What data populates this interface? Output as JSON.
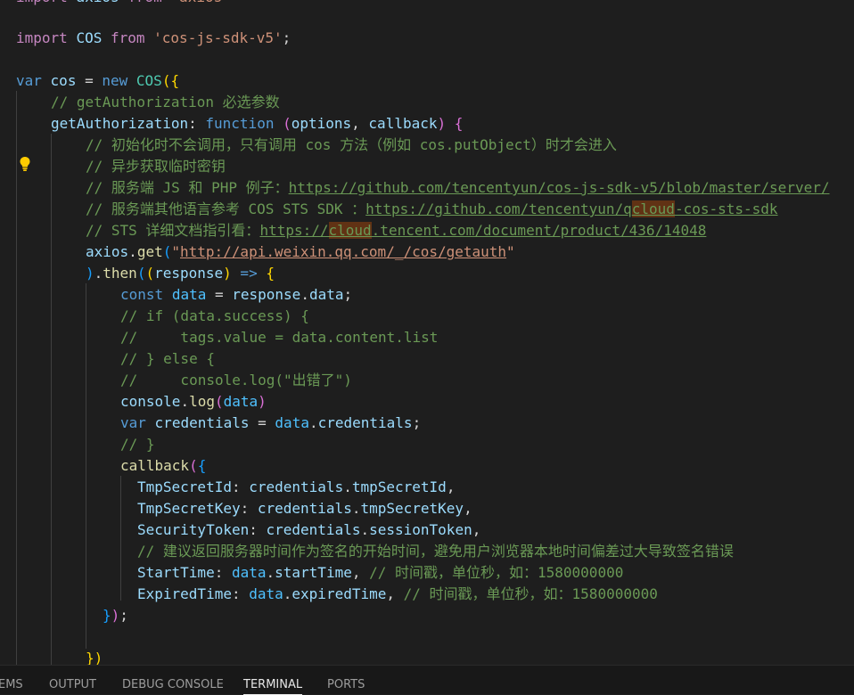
{
  "editor": {
    "language": "javascript",
    "lines": {
      "l0": "import axios from 'axios'",
      "l2_import": "import",
      "l2_name": "COS",
      "l2_from": "from",
      "l2_module": "'cos-js-sdk-v5'",
      "l2_semi": ";",
      "l4_var": "var",
      "l4_name": "cos",
      "l4_eq": " = ",
      "l4_new": "new",
      "l4_cls": "COS",
      "l4_open": "({",
      "l5_comment": "// getAuthorization 必选参数",
      "l6_key": "getAuthorization",
      "l6_colon": ": ",
      "l6_function": "function",
      "l6_params_open": " (",
      "l6_p1": "options",
      "l6_comma": ", ",
      "l6_p2": "callback",
      "l6_params_close": ") {",
      "l7_comment": "// 初始化时不会调用，只有调用 cos 方法（例如 cos.putObject）时才会进入",
      "l8_comment": "// 异步获取临时密钥",
      "l9_comment_prefix": "// 服务端 JS 和 PHP 例子：",
      "l9_link": "https://github.com/tencentyun/cos-js-sdk-v5/blob/master/server/",
      "l10_comment_prefix": "// 服务端其他语言参考 COS STS SDK ：",
      "l10_link_a": "https://github.com/tencentyun/q",
      "l10_link_hl": "cloud",
      "l10_link_b": "-cos-sts-sdk",
      "l11_comment_prefix": "// STS 详细文档指引看：",
      "l11_link_a": "https://",
      "l11_link_hl": "cloud",
      "l11_link_b": ".tencent.com/document/product/436/14048",
      "l12_obj": "axios",
      "l12_dot": ".",
      "l12_fn": "get",
      "l12_open": "(",
      "l12_q1": "\"",
      "l12_url": "http://api.weixin.qq.com/_/cos/getauth",
      "l12_q2": "\"",
      "l13_close": ")",
      "l13_dot": ".",
      "l13_fn": "then",
      "l13_open1": "(",
      "l13_open2": "(",
      "l13_param": "response",
      "l13_close2": ")",
      "l13_arrow": " => ",
      "l13_brace": "{",
      "l14_const": "const",
      "l14_name": "data",
      "l14_eq": " = ",
      "l14_obj": "response",
      "l14_dot": ".",
      "l14_prop": "data",
      "l14_semi": ";",
      "l15_comment": "// if (data.success) {",
      "l16_comment": "//     tags.value = data.content.list",
      "l17_comment": "// } else {",
      "l18_comment": "//     console.log(\"出错了\")",
      "l19_obj": "console",
      "l19_dot": ".",
      "l19_fn": "log",
      "l19_open": "(",
      "l19_arg": "data",
      "l19_close": ")",
      "l20_var": "var",
      "l20_name": "credentials",
      "l20_eq": " = ",
      "l20_obj": "data",
      "l20_dot": ".",
      "l20_prop": "credentials",
      "l20_semi": ";",
      "l21_comment": "// }",
      "l22_fn": "callback",
      "l22_open1": "(",
      "l22_open2": "{",
      "l23_key": "TmpSecretId",
      "l23_colon": ": ",
      "l23_obj": "credentials",
      "l23_dot": ".",
      "l23_prop": "tmpSecretId",
      "l23_comma": ",",
      "l24_key": "TmpSecretKey",
      "l24_colon": ": ",
      "l24_obj": "credentials",
      "l24_dot": ".",
      "l24_prop": "tmpSecretKey",
      "l24_comma": ",",
      "l25_key": "SecurityToken",
      "l25_colon": ": ",
      "l25_obj": "credentials",
      "l25_dot": ".",
      "l25_prop": "sessionToken",
      "l25_comma": ",",
      "l26_comment": "// 建议返回服务器时间作为签名的开始时间，避免用户浏览器本地时间偏差过大导致签名错误",
      "l27_key": "StartTime",
      "l27_colon": ": ",
      "l27_obj": "data",
      "l27_dot": ".",
      "l27_prop": "startTime",
      "l27_comma": ", ",
      "l27_comment": "// 时间戳，单位秒，如：1580000000",
      "l28_key": "ExpiredTime",
      "l28_colon": ": ",
      "l28_obj": "data",
      "l28_dot": ".",
      "l28_prop": "expiredTime",
      "l28_comma": ", ",
      "l28_comment": "// 时间戳，单位秒，如：1580000000",
      "l29_close": "}",
      "l29_paren": ")",
      "l29_semi": ";",
      "l31_close": "})"
    }
  },
  "panel": {
    "tabs": [
      "EMS",
      "OUTPUT",
      "DEBUG CONSOLE",
      "TERMINAL",
      "PORTS"
    ],
    "active_tab": "TERMINAL"
  },
  "icons": {
    "lightbulb": "lightbulb-icon"
  },
  "colors": {
    "background": "#1e1e1e",
    "keyword": "#569cd6",
    "control_keyword": "#c586c0",
    "string": "#ce9178",
    "comment": "#6a9955",
    "variable": "#9cdcfe",
    "class": "#4ec9b0",
    "function": "#dcdcaa",
    "bracket_1": "#ffd700",
    "bracket_2": "#da70d6",
    "bracket_3": "#179fff",
    "find_highlight": "#613214",
    "lightbulb": "#ffcc00"
  }
}
